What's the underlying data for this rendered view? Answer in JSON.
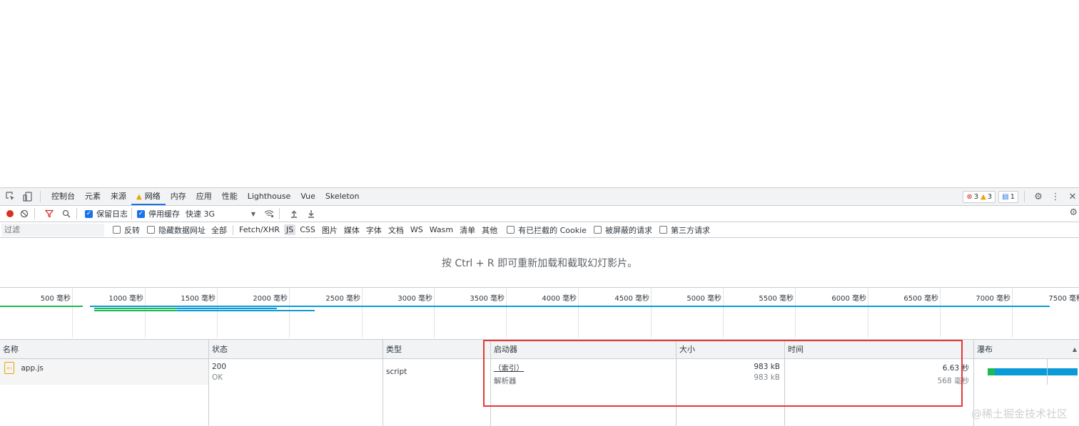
{
  "tabbar": {
    "tabs": [
      {
        "label": "控制台",
        "active": false
      },
      {
        "label": "元素",
        "active": false
      },
      {
        "label": "来源",
        "active": false
      },
      {
        "label": "网络",
        "active": true,
        "warning": true
      },
      {
        "label": "内存",
        "active": false
      },
      {
        "label": "应用",
        "active": false
      },
      {
        "label": "性能",
        "active": false
      },
      {
        "label": "Lighthouse",
        "active": false
      },
      {
        "label": "Vue",
        "active": false
      },
      {
        "label": "Skeleton",
        "active": false
      }
    ],
    "error_count": "3",
    "warning_count": "3",
    "message_count": "1"
  },
  "toolbar": {
    "preserve_log_label": "保留日志",
    "preserve_log_checked": true,
    "disable_cache_label": "停用缓存",
    "disable_cache_checked": true,
    "throttle_value": "快速 3G"
  },
  "filterbar": {
    "filter_placeholder": "过滤",
    "invert_label": "反转",
    "hide_data_urls_label": "隐藏数据网址",
    "types": [
      "全部",
      "Fetch/XHR",
      "JS",
      "CSS",
      "图片",
      "媒体",
      "字体",
      "文档",
      "WS",
      "Wasm",
      "清单",
      "其他"
    ],
    "selected_type": "JS",
    "blocked_cookies_label": "有已拦截的 Cookie",
    "blocked_requests_label": "被屏蔽的请求",
    "third_party_label": "第三方请求"
  },
  "filmstrip_hint": "按 Ctrl + R 即可重新加载和截取幻灯影片。",
  "overview": {
    "tick_labels": [
      "500 毫秒",
      "1000 毫秒",
      "1500 毫秒",
      "2000 毫秒",
      "2500 毫秒",
      "3000 毫秒",
      "3500 毫秒",
      "4000 毫秒",
      "4500 毫秒",
      "5000 毫秒",
      "5500 毫秒",
      "6000 毫秒",
      "6500 毫秒",
      "7000 毫秒",
      "7500 毫秒"
    ]
  },
  "table": {
    "columns": [
      "名称",
      "状态",
      "类型",
      "启动器",
      "大小",
      "时间",
      "瀑布"
    ],
    "rows": [
      {
        "name": "app.js",
        "status": "200",
        "status_text": "OK",
        "type": "script",
        "initiator": "（索引）",
        "initiator_sub": "解析器",
        "size": "983 kB",
        "size_sub": "983 kB",
        "time": "6.63 秒",
        "time_sub": "568 毫秒"
      }
    ]
  },
  "watermark": "@稀土掘金技术社区",
  "colors": {
    "accent": "#1a73e8",
    "error": "#d93025",
    "warning": "#e8a600",
    "highlight_box": "#e53935",
    "waterfall_wait": "#1db954",
    "waterfall_download": "#0a9ad7"
  }
}
